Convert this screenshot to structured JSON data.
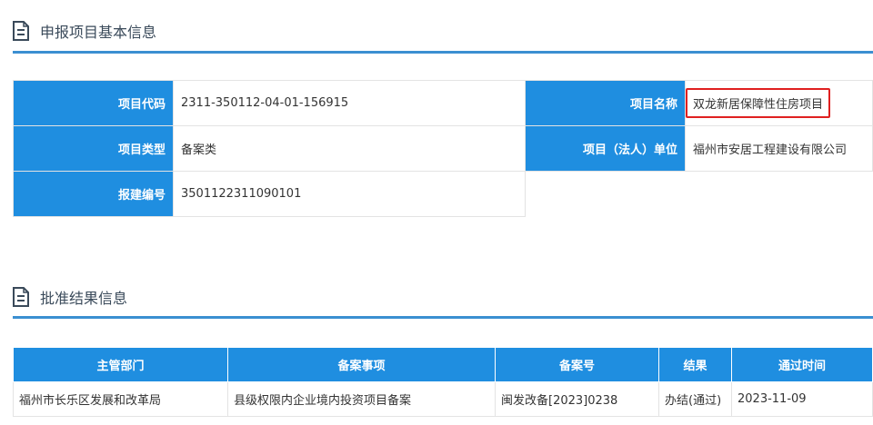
{
  "project_section": {
    "title": "申报项目基本信息",
    "fields": {
      "code_label": "项目代码",
      "code_value": "2311-350112-04-01-156915",
      "name_label": "项目名称",
      "name_value": "双龙新居保障性住房项目",
      "type_label": "项目类型",
      "type_value": "备案类",
      "unit_label": "项目（法人）单位",
      "unit_value": "福州市安居工程建设有限公司",
      "build_label": "报建编号",
      "build_value": "3501122311090101"
    }
  },
  "result_section": {
    "title": "批准结果信息",
    "headers": [
      "主管部门",
      "备案事项",
      "备案号",
      "结果",
      "通过时间"
    ],
    "rows": [
      [
        "福州市长乐区发展和改革局",
        "县级权限内企业境内投资项目备案",
        "闽发改备[2023]0238",
        "办结(通过)",
        "2023-11-09"
      ]
    ]
  },
  "colors": {
    "accent": "#1f8ee0",
    "rule": "#3b8fd1",
    "highlight": "#e02020"
  },
  "icons": [
    "document-icon"
  ]
}
